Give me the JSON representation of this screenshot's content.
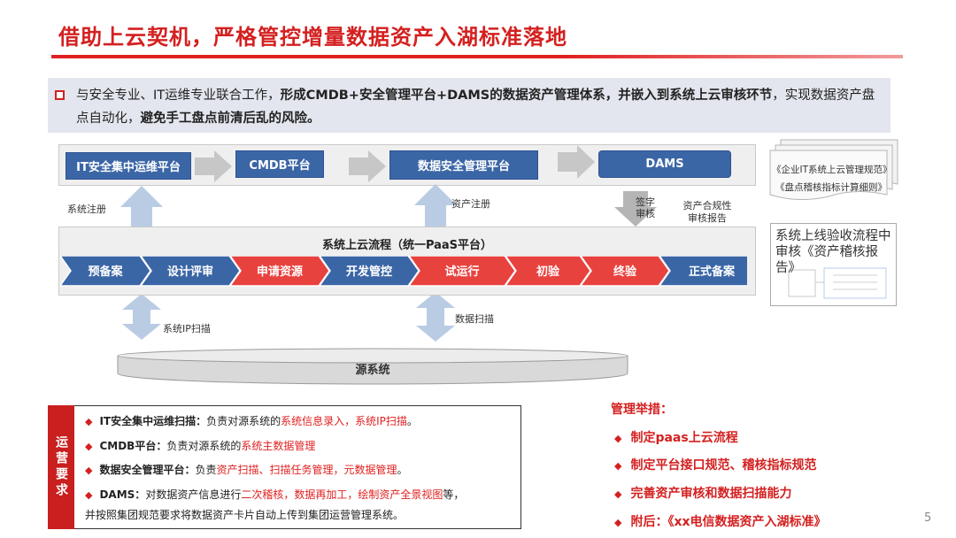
{
  "title": "借助上云契机，严格管控增量数据资产入湖标准落地",
  "intro": {
    "part1": "与安全专业、IT运维专业联合工作，",
    "part2_bold": "形成CMDB+安全管理平台+DAMS的数据资产管理体系，并嵌入到系统上云审核环节",
    "part3": "，实现数据资产盘点自动化，",
    "part4_bold": "避免手工盘点前清后乱的风险。"
  },
  "platforms": [
    "IT安全集中运维平台",
    "CMDB平台",
    "数据安全管理平台",
    "DAMS"
  ],
  "labels": {
    "sys_register": "系统注册",
    "asset_register": "资产注册",
    "sign_review": "签字\n审核",
    "compliance_report": "资产合规性\n审核报告",
    "ip_scan": "系统IP扫描",
    "data_scan": "数据扫描",
    "source_system": "源系统"
  },
  "flow": {
    "title": "系统上云流程（统一PaaS平台）",
    "steps": [
      {
        "label": "预备案",
        "color": "blue"
      },
      {
        "label": "设计评审",
        "color": "blue"
      },
      {
        "label": "申请资源",
        "color": "red"
      },
      {
        "label": "开发管控",
        "color": "blue"
      },
      {
        "label": "试运行",
        "color": "red"
      },
      {
        "label": "初验",
        "color": "red"
      },
      {
        "label": "终验",
        "color": "red"
      },
      {
        "label": "正式备案",
        "color": "blue"
      }
    ]
  },
  "docs": [
    "《企业IT系统上云管理规范》",
    "《盘点稽核指标计算细则》"
  ],
  "note": "系统上线验收流程中审核《资产稽核报告》",
  "requirements": {
    "side_label": "运营要求",
    "items": [
      {
        "name": "IT安全集中运维扫描：",
        "text": "负责对源系统的",
        "red": "系统信息录入，系统IP扫描",
        "tail": "。"
      },
      {
        "name": "CMDB平台：",
        "text": "负责对源系统的",
        "red": "系统主数据管理",
        "tail": ""
      },
      {
        "name": "数据安全管理平台：",
        "text": "负责",
        "red": "资产扫描、扫描任务管理，元数据管理",
        "tail": "。"
      },
      {
        "name": "DAMS：",
        "text": "对数据资产信息进行",
        "red": "二次稽核，数据再加工，绘制资产全景视图",
        "tail": "等，",
        "line2": "并按照集团规范要求将数据资产卡片自动上传到集团运营管理系统。"
      }
    ]
  },
  "measures": {
    "title": "管理举措：",
    "items": [
      "制定paas上云流程",
      "制定平台接口规范、稽核指标规范",
      "完善资产审核和数据扫描能力",
      "附后：《xx电信数据资产入湖标准》"
    ]
  },
  "page_number": "5",
  "colors": {
    "accent_red": "#d42020",
    "platform_blue": "#3b66a6",
    "step_red": "#e8423f"
  }
}
